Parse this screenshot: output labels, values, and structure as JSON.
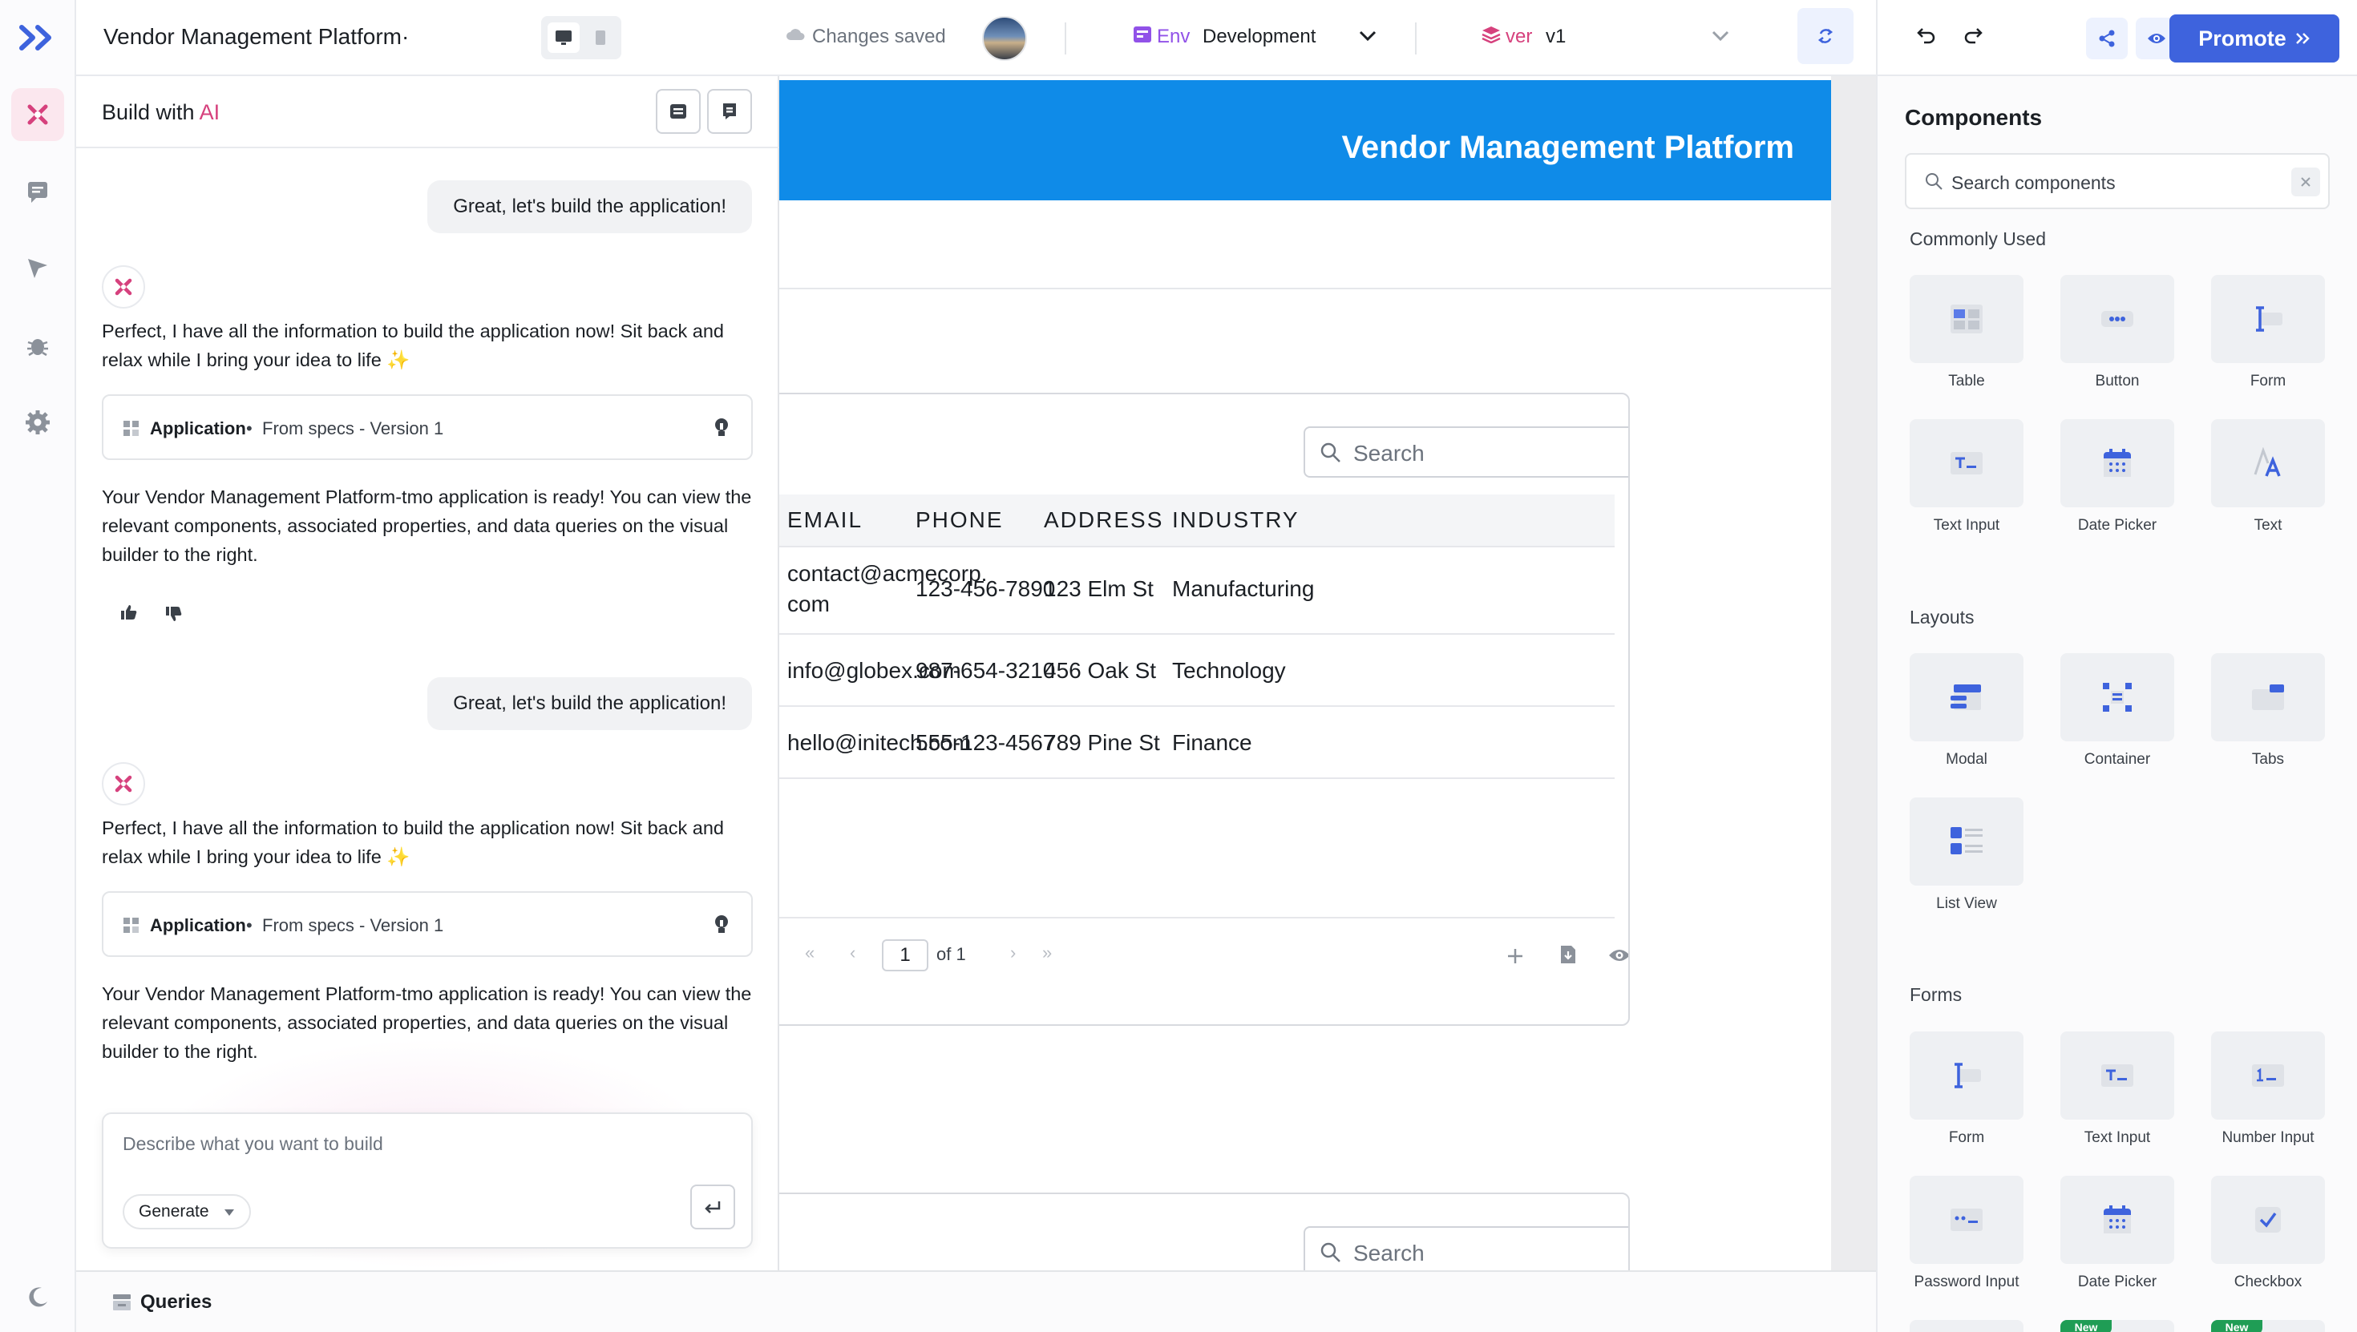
{
  "app": {
    "title": "Vendor Management Platform·",
    "save_status": "Changes saved",
    "env_label": "Env",
    "env_value": "Development",
    "ver_label": "ver",
    "ver_value": "v1",
    "promote_label": "Promote",
    "accent": "#3e63dd",
    "brand": "#0f8be8"
  },
  "ai_panel": {
    "title_prefix": "Build with",
    "title_accent": "AI",
    "messages": [
      {
        "role": "user",
        "text": "Great, let's build the application!"
      },
      {
        "role": "ai",
        "text": "Perfect, I have all the information to build the application now! Sit back and relax while I bring your idea to life ✨"
      },
      {
        "role": "card",
        "title": "Application",
        "subtitle": "From specs - Version 1"
      },
      {
        "role": "ai",
        "text": "Your Vendor Management Platform-tmo application is ready! You can view the relevant components, associated properties, and data queries on the visual builder to the right."
      },
      {
        "role": "user",
        "text": "Great, let's build the application!"
      },
      {
        "role": "ai",
        "text": "Perfect, I have all the information to build the application now! Sit back and relax while I bring your idea to life ✨"
      },
      {
        "role": "card",
        "title": "Application",
        "subtitle": "From specs - Version 1"
      },
      {
        "role": "ai",
        "text": "Your Vendor Management Platform-tmo application is ready! You can view the relevant components, associated properties, and data queries on the visual builder to the right."
      }
    ],
    "input_placeholder": "Describe what you want to build",
    "generate_label": "Generate"
  },
  "canvas": {
    "app_header_title": "Vendor Management Platform",
    "table": {
      "search_placeholder": "Search",
      "columns": [
        "EMAIL",
        "PHONE",
        "ADDRESS",
        "INDUSTRY"
      ],
      "rows": [
        [
          "contact@acmecorp.com",
          "123-456-7890",
          "123 Elm St",
          "Manufacturing"
        ],
        [
          "info@globex.com",
          "987-654-3210",
          "456 Oak St",
          "Technology"
        ],
        [
          "hello@initech.com",
          "555-123-4567",
          "789 Pine St",
          "Finance"
        ]
      ],
      "row0_email_line1": "contact@acmecorp.",
      "row0_email_line2": "com",
      "page_current": "1",
      "page_of": "of 1"
    },
    "table2": {
      "search_placeholder": "Search"
    }
  },
  "components_panel": {
    "title": "Components",
    "search_placeholder": "Search components",
    "sections": [
      {
        "title": "Commonly Used",
        "items": [
          "Table",
          "Button",
          "Form",
          "Text Input",
          "Date Picker",
          "Text"
        ]
      },
      {
        "title": "Layouts",
        "items": [
          "Modal",
          "Container",
          "Tabs",
          "List View"
        ]
      },
      {
        "title": "Forms",
        "items": [
          "Form",
          "Text Input",
          "Number Input",
          "Password Input",
          "Date Picker",
          "Checkbox"
        ]
      }
    ],
    "new_badge": "New"
  },
  "bottombar": {
    "queries_label": "Queries"
  }
}
